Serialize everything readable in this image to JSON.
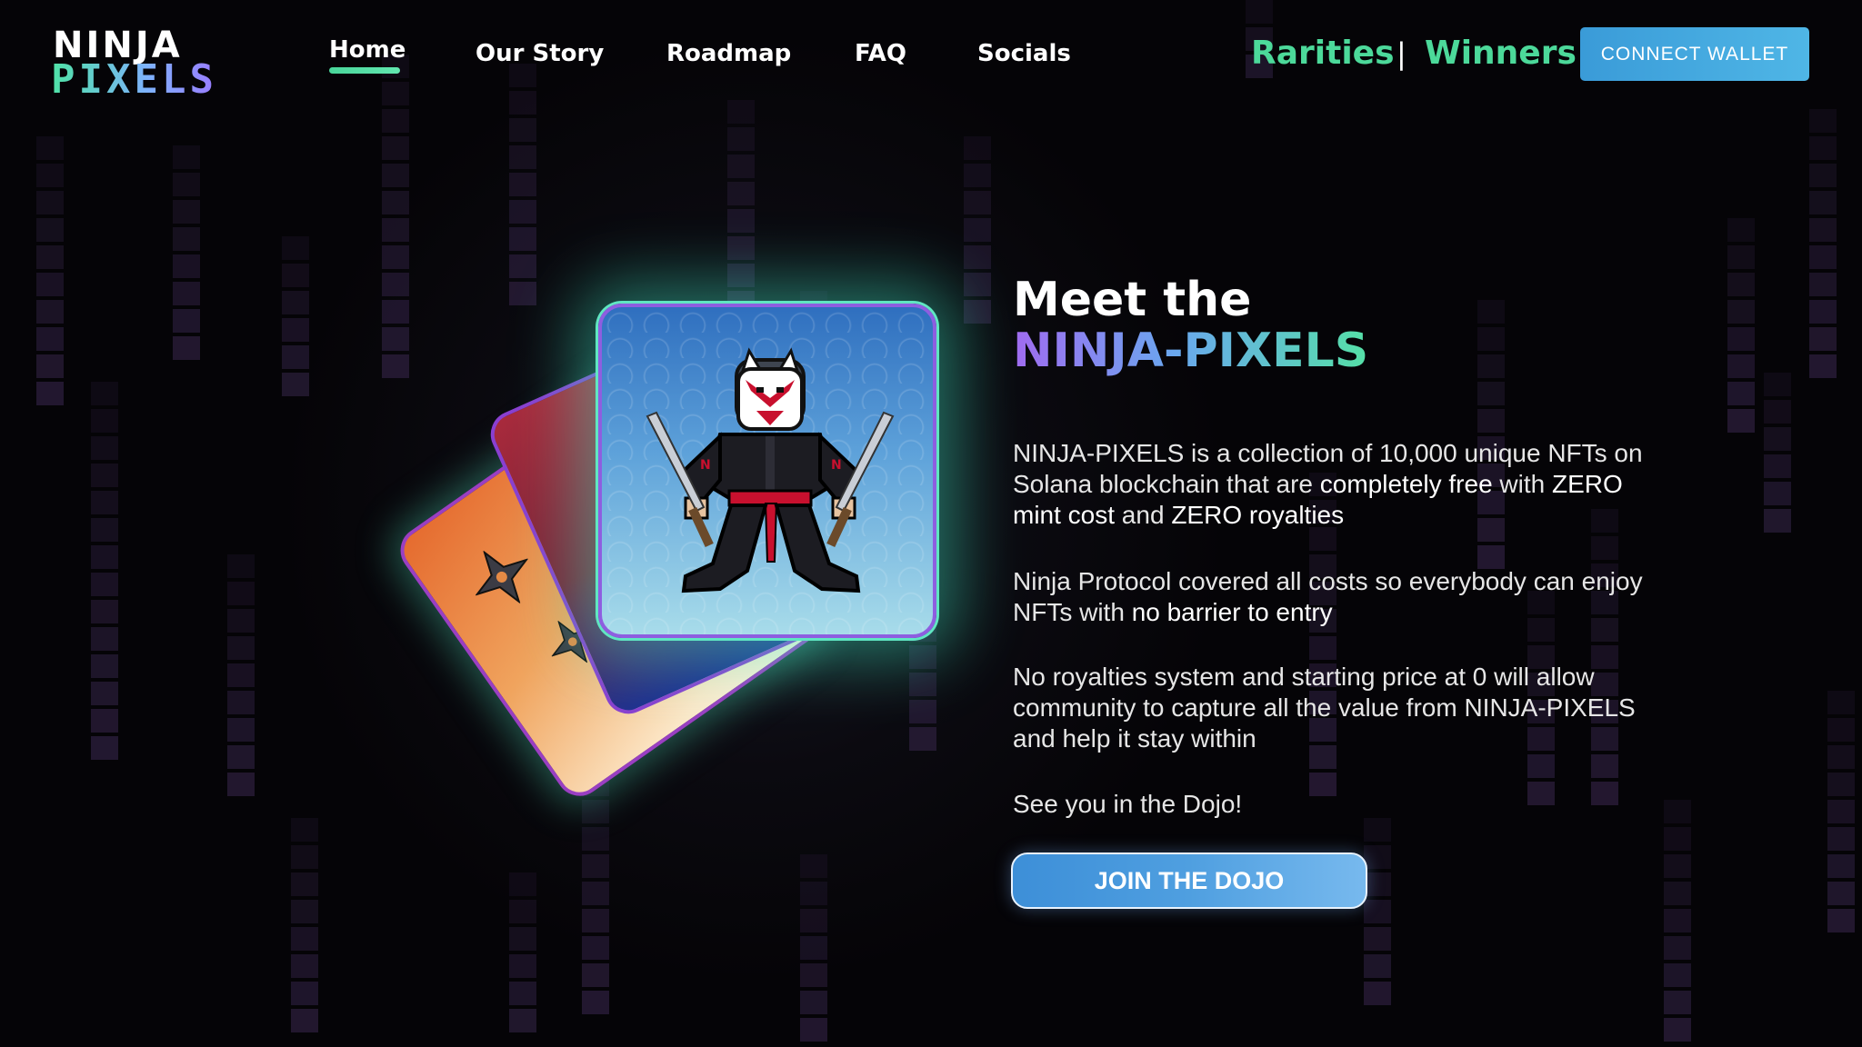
{
  "logo": {
    "line1": "NINJA",
    "line2": "PIXELS"
  },
  "nav": {
    "items": [
      {
        "label": "Home",
        "active": true
      },
      {
        "label": "Our Story"
      },
      {
        "label": "Roadmap"
      },
      {
        "label": "FAQ"
      },
      {
        "label": "Socials"
      }
    ]
  },
  "header": {
    "rarities_label": "Rarities",
    "divider": "|",
    "winners_label": "Winners",
    "connect_label": "CONNECT WALLET"
  },
  "hero": {
    "title_line1": "Meet the",
    "title_line2": "NINJA-PIXELS",
    "para1": {
      "text_a": "NINJA-PIXELS is a collection of 10,000 unique NFTs on Solana blockchain that are ",
      "bold_a": "completely free",
      "text_b": " with ",
      "bold_b": "ZERO mint cost",
      "text_c": " and ",
      "bold_c": "ZERO royalties"
    },
    "para2": {
      "text_a": "Ninja Protocol covered all costs so everybody can enjoy NFTs with ",
      "bold_a": "no barrier to entry"
    },
    "para3": "No royalties system and starting price at 0 will allow community to capture all the value from NINJA-PIXELS and help it stay within",
    "para4": "See you in the Dojo!",
    "cta_label": "JOIN THE DOJO"
  },
  "colors": {
    "accent_green": "#4cd99a",
    "accent_blue": "#3a9bd8",
    "accent_purple": "#9a5ee0",
    "background": "#050407"
  },
  "icons": [
    "shuriken-icon",
    "ninja-character-image"
  ]
}
